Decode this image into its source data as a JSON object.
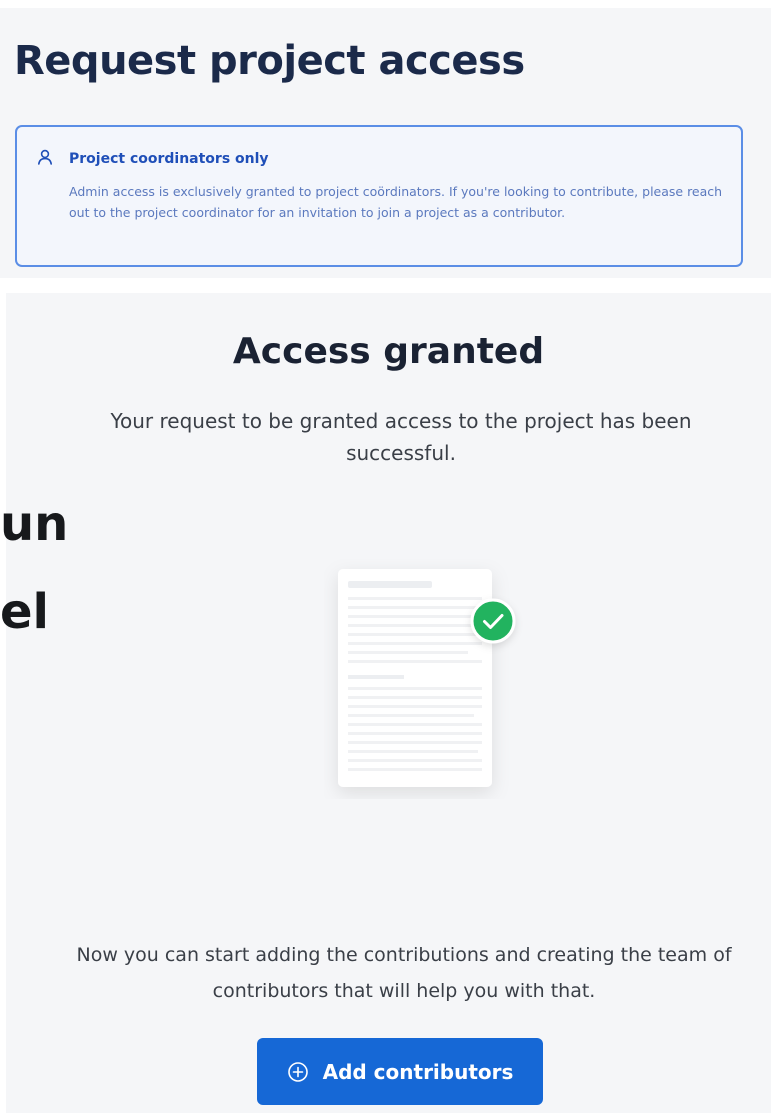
{
  "request_section": {
    "title": "Request project access",
    "notice": {
      "icon": "user-icon",
      "title": "Project coordinators only",
      "body": "Admin access is exclusively granted to project coördinators. If you're looking to contribute, please reach out to the project coordinator for an invitation to join a project as a contributor."
    }
  },
  "background_fragments": {
    "line1": "un",
    "line2": "el"
  },
  "success_section": {
    "title": "Access granted",
    "message": "Your request to be granted access to the project has been successful.",
    "illustration": "document-check-icon",
    "next_message": "Now you can start adding the contributions and creating the team of contributors that will help you with that.",
    "add_button": {
      "icon": "plus-circle-icon",
      "label": "Add contributors"
    }
  },
  "colors": {
    "accent": "#1668d6",
    "notice_border": "#5b8ee6",
    "notice_title": "#1f4fb8",
    "success_green": "#22b35e",
    "title_text": "#1b2a4a"
  }
}
